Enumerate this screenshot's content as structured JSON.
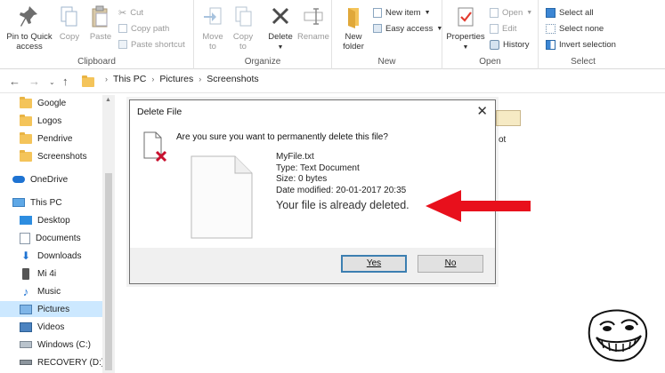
{
  "ribbon": {
    "clipboard": {
      "pin_label_1": "Pin to Quick",
      "pin_label_2": "access",
      "copy_label": "Copy",
      "paste_label": "Paste",
      "cut_label": "Cut",
      "copy_path_label": "Copy path",
      "paste_shortcut_label": "Paste shortcut",
      "group_label": "Clipboard"
    },
    "organize": {
      "move_to_1": "Move",
      "move_to_2": "to",
      "copy_to_1": "Copy",
      "copy_to_2": "to",
      "delete_label": "Delete",
      "rename_label": "Rename",
      "group_label": "Organize"
    },
    "new": {
      "new_folder_1": "New",
      "new_folder_2": "folder",
      "new_item_label": "New item",
      "easy_access_label": "Easy access",
      "group_label": "New"
    },
    "open": {
      "properties_label": "Properties",
      "open_label": "Open",
      "edit_label": "Edit",
      "history_label": "History",
      "group_label": "Open"
    },
    "select": {
      "select_all_label": "Select all",
      "select_none_label": "Select none",
      "invert_label": "Invert selection",
      "group_label": "Select"
    }
  },
  "address": {
    "crumbs": [
      "This PC",
      "Pictures",
      "Screenshots"
    ]
  },
  "nav": {
    "items": [
      {
        "label": "Google"
      },
      {
        "label": "Logos"
      },
      {
        "label": "Pendrive"
      },
      {
        "label": "Screenshots"
      },
      {
        "label": "OneDrive"
      },
      {
        "label": "This PC"
      },
      {
        "label": "Desktop"
      },
      {
        "label": "Documents"
      },
      {
        "label": "Downloads"
      },
      {
        "label": "Mi 4i"
      },
      {
        "label": "Music"
      },
      {
        "label": "Pictures"
      },
      {
        "label": "Videos"
      },
      {
        "label": "Windows (C:)"
      },
      {
        "label": "RECOVERY (D:)"
      }
    ]
  },
  "content": {
    "partial_file_label": "ot"
  },
  "dialog": {
    "title": "Delete File",
    "question": "Are you sure you want to permanently delete this file?",
    "file_name": "MyFile.txt",
    "file_type": "Type: Text Document",
    "file_size": "Size: 0 bytes",
    "file_modified": "Date modified: 20-01-2017 20:35",
    "annotation": "Your file is already deleted.",
    "yes_label": "Yes",
    "no_label": "No"
  },
  "colors": {
    "selection": "#cce8ff",
    "arrow": "#e8101c",
    "folder": "#f4c45a",
    "accent": "#3c7fb1"
  }
}
